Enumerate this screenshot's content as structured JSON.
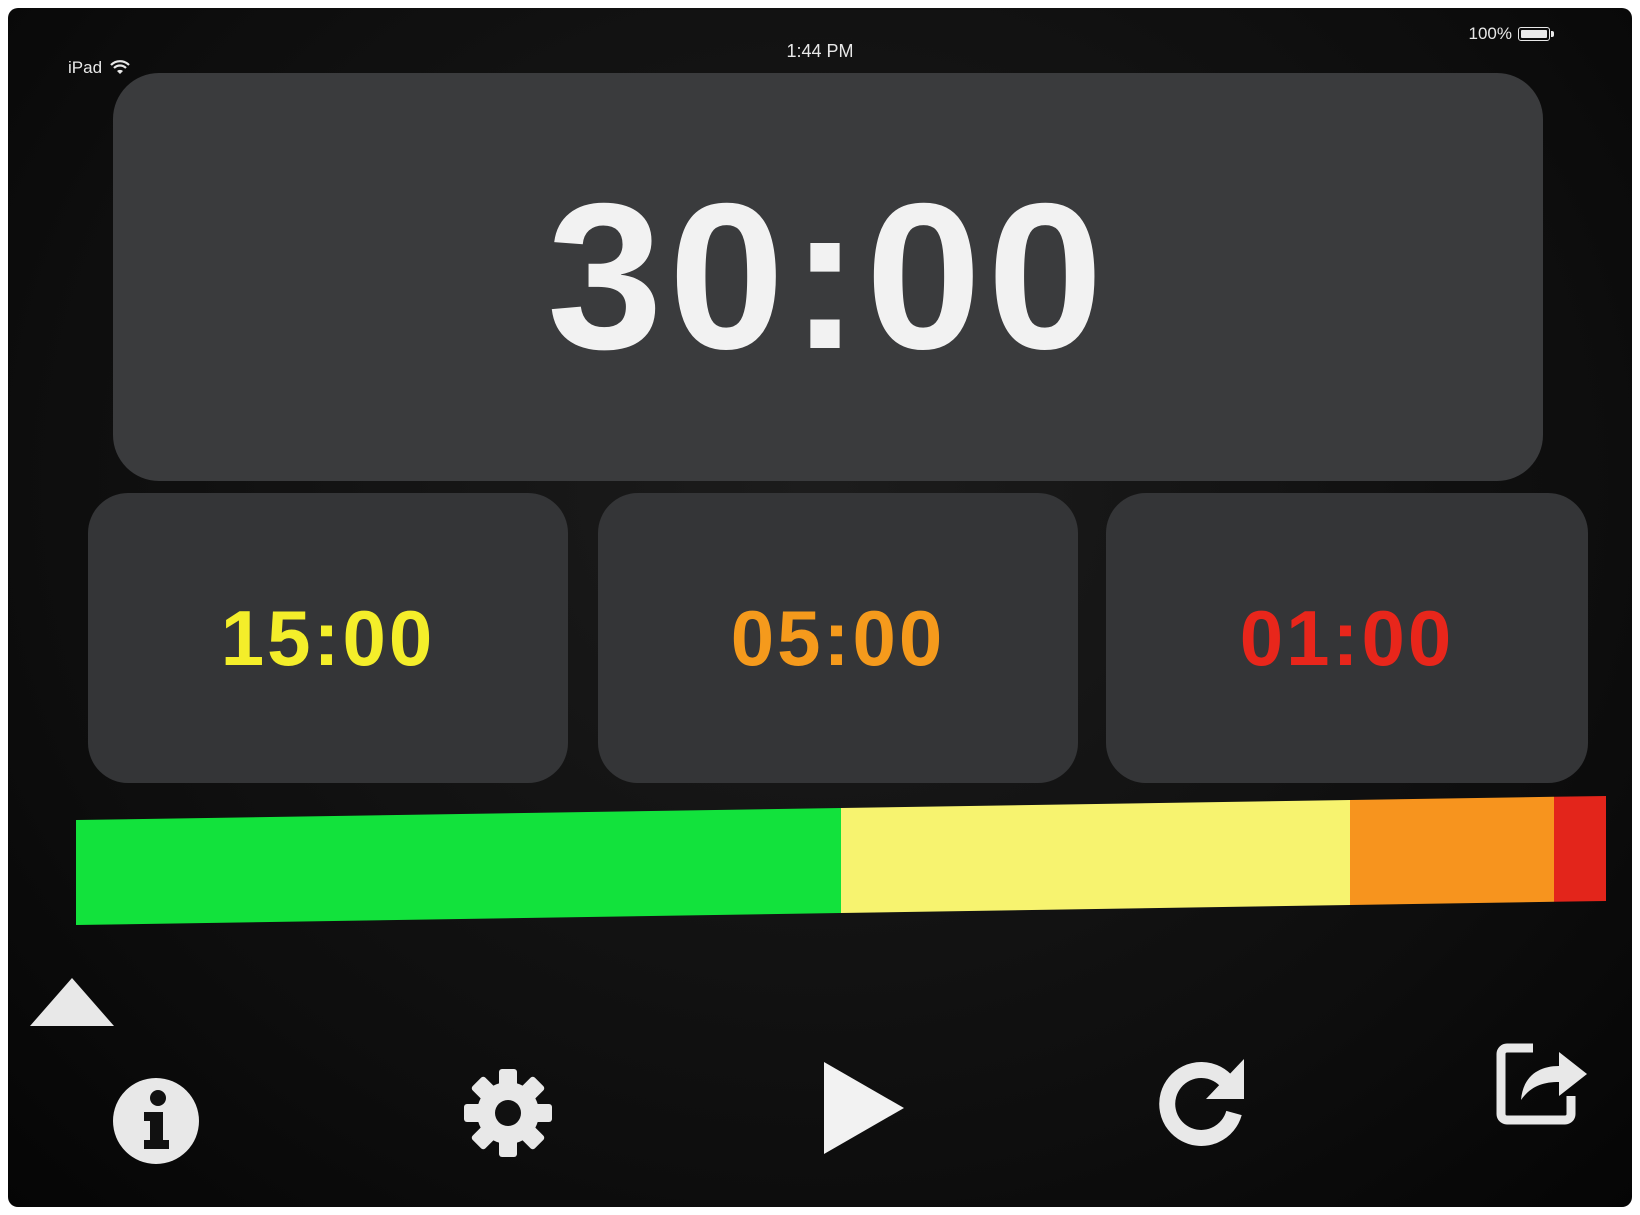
{
  "status_bar": {
    "device": "iPad",
    "time": "1:44 PM",
    "battery": "100%"
  },
  "main_timer": {
    "time": "30:00",
    "color": "#f2f2f2"
  },
  "presets": [
    {
      "time": "15:00",
      "color": "#f4ee2a"
    },
    {
      "time": "05:00",
      "color": "#f59a1c"
    },
    {
      "time": "01:00",
      "color": "#e8261b"
    }
  ],
  "progress_bar": {
    "progress": 0,
    "segments": [
      {
        "name": "green",
        "fraction": 0.5,
        "color": "#12e23c"
      },
      {
        "name": "yellow",
        "fraction": 0.333,
        "color": "#f7f36f"
      },
      {
        "name": "orange",
        "fraction": 0.133,
        "color": "#f7941e"
      },
      {
        "name": "red",
        "fraction": 0.034,
        "color": "#e3251b"
      }
    ]
  },
  "toolbar": {
    "items": [
      {
        "icon": "info-icon"
      },
      {
        "icon": "gear-icon"
      },
      {
        "icon": "play-icon"
      },
      {
        "icon": "reset-icon"
      },
      {
        "icon": "share-icon"
      }
    ]
  }
}
